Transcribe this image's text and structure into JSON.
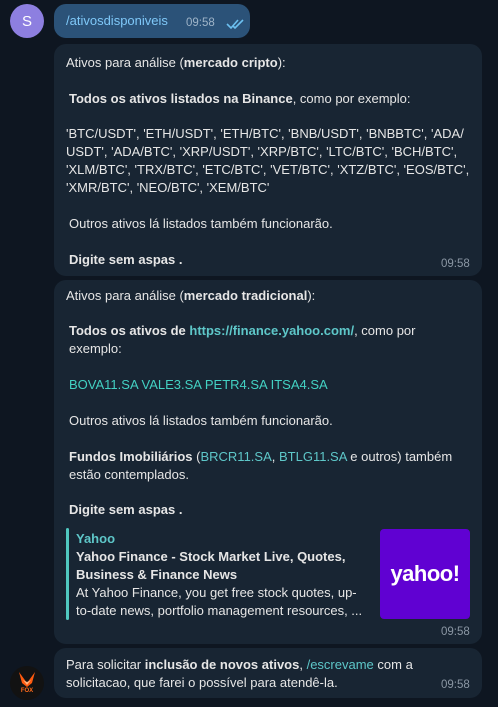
{
  "user": {
    "avatar_letter": "S"
  },
  "outgoing": {
    "text": "/ativosdisponiveis",
    "time": "09:58"
  },
  "msg1": {
    "l1a": "Ativos para análise (",
    "l1b": "mercado cripto",
    "l1c": "):",
    "l2a": "Todos os ativos listados na Binance",
    "l2b": ", como por exemplo:",
    "l3": " 'BTC/USDT', 'ETH/USDT', 'ETH/BTC', 'BNB/USDT', 'BNBBTC', 'ADA/",
    "l4": "USDT', 'ADA/BTC', 'XRP/USDT', 'XRP/BTC', 'LTC/BTC', 'BCH/BTC',",
    "l5": "'XLM/BTC', 'TRX/BTC', 'ETC/BTC', 'VET/BTC', 'XTZ/BTC', 'EOS/BTC',",
    "l6": "'XMR/BTC', 'NEO/BTC', 'XEM/BTC'",
    "l7": "Outros ativos lá listados também funcionarão.",
    "l8": "Digite sem aspas .",
    "time": "09:58"
  },
  "msg2": {
    "l1a": "Ativos para análise (",
    "l1b": "mercado tradicional",
    "l1c": "):",
    "l2a": "Todos os ativos de ",
    "l2link": "https://finance.yahoo.com/",
    "l2c": ", como por",
    "l3": "exemplo:",
    "l4": "BOVA11.SA VALE3.SA PETR4.SA ITSA4.SA",
    "l5": "Outros ativos lá listados também funcionarão.",
    "l6a": "Fundos Imobiliários",
    "l6b": " (",
    "l6link1": "BRCR11.SA",
    "l6c": ", ",
    "l6link2": "BTLG11.SA",
    "l6d": " e outros) também",
    "l7": "estão contemplados.",
    "l8": "Digite sem aspas .",
    "preview": {
      "site": "Yahoo",
      "title1": "Yahoo Finance - Stock Market Live, Quotes,",
      "title2": "Business & Finance News",
      "desc1": "At Yahoo Finance, you get free stock quotes, up-",
      "desc2": "to-date news, portfolio management resources, ...",
      "logo_text": "yahoo!"
    },
    "time": "09:58"
  },
  "msg3": {
    "l1a": "Para solicitar ",
    "l1b": "inclusão de novos ativos",
    "l1c": ", ",
    "l1link": "/escrevame",
    "l1d": " com a",
    "l2": "solicitacao, que farei o possível para atendê-la.",
    "time": "09:58"
  },
  "bot": {
    "avatar_label": "FOX"
  },
  "colors": {
    "background": "#0e1621",
    "incoming_bubble": "#182533",
    "outgoing_bubble": "#2b5278",
    "link": "#5ec7c9",
    "yahoo_purple": "#6001d2"
  }
}
